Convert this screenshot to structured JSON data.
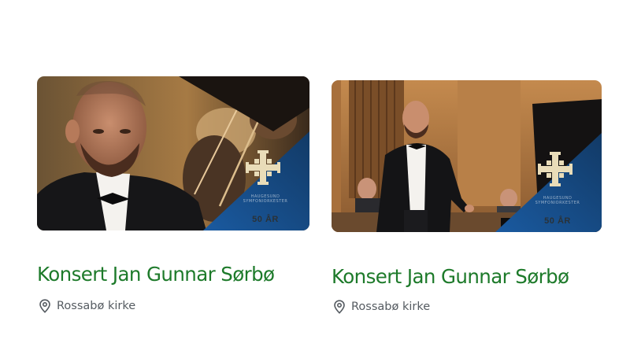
{
  "events": [
    {
      "title": "Konsert Jan Gunnar Sørbø",
      "location": "Rossabø kirke",
      "location_icon": "map-pin-icon",
      "image_alt": "Pianist in tuxedo in front of orchestra",
      "badge": {
        "org_text": "HAUGESUND SYMFONIORKESTER",
        "years_text": "50 ÅR",
        "icon": "cross-emblem-icon"
      }
    },
    {
      "title": "Konsert Jan Gunnar Sørbø",
      "location": "Rossabø kirke",
      "location_icon": "map-pin-icon",
      "image_alt": "Pianist bowing on stage next to grand piano",
      "badge": {
        "org_text": "HAUGESUND SYMFONIORKESTER",
        "years_text": "50 ÅR",
        "icon": "cross-emblem-icon"
      }
    }
  ],
  "colors": {
    "title": "#1d7a2a",
    "location_text": "#555b61",
    "badge_blue": "#1f5f9c"
  }
}
